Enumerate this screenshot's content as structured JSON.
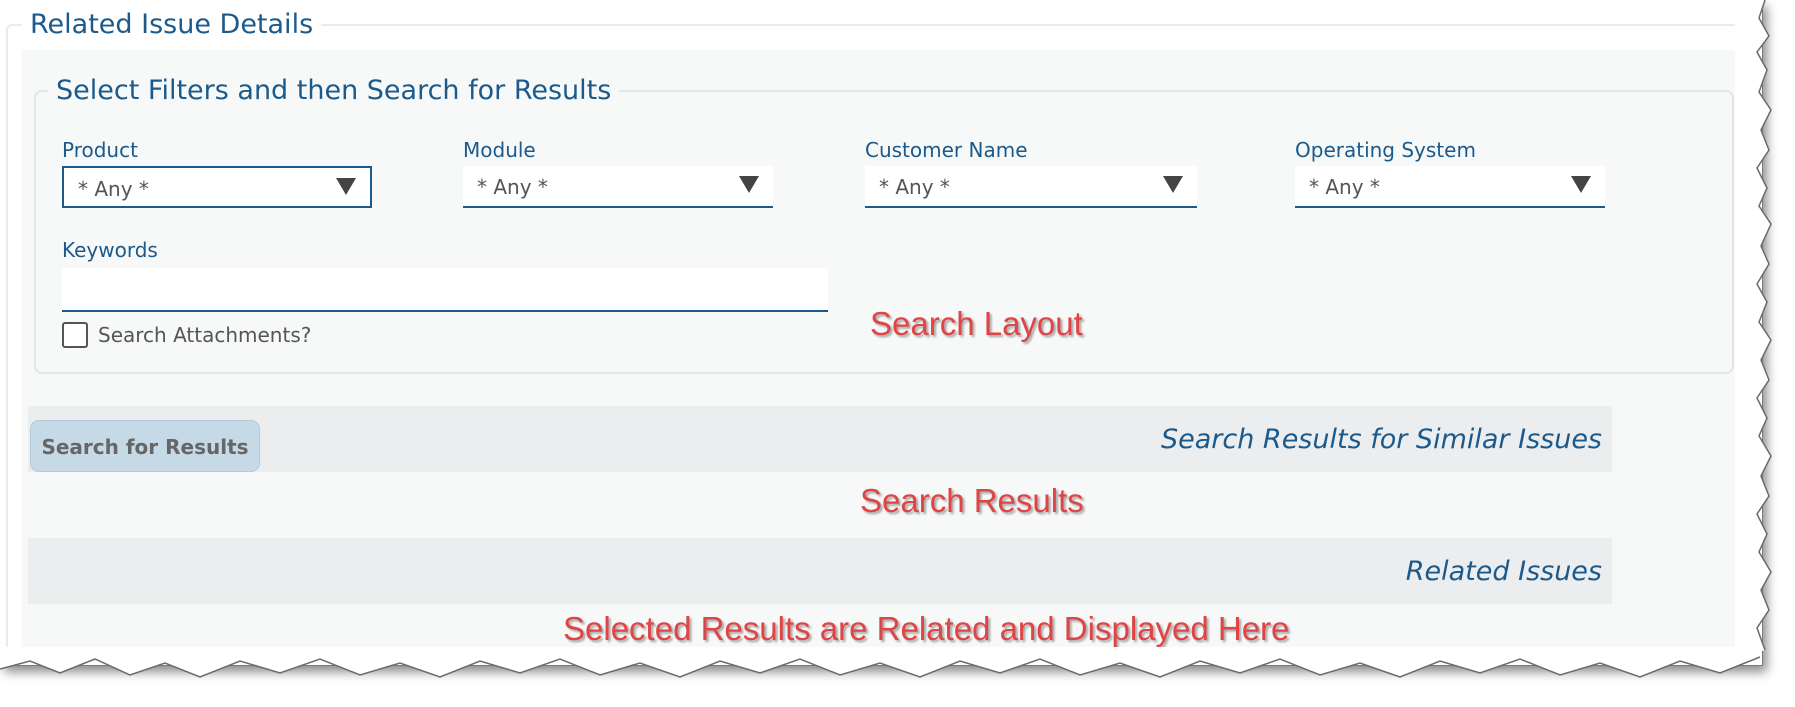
{
  "section_title": "Related Issue Details",
  "filters": {
    "legend": "Select Filters and then Search for Results",
    "product": {
      "label": "Product",
      "value": "* Any *"
    },
    "module": {
      "label": "Module",
      "value": "* Any *"
    },
    "customer_name": {
      "label": "Customer Name",
      "value": "* Any *"
    },
    "operating_system": {
      "label": "Operating System",
      "value": "* Any *"
    },
    "keywords": {
      "label": "Keywords",
      "value": ""
    },
    "search_attachments": {
      "label": "Search Attachments?",
      "checked": false
    }
  },
  "search_button_label": "Search for Results",
  "search_results_title": "Search Results for Similar Issues",
  "related_issues_title": "Related Issues",
  "annotations": {
    "search_layout": "Search Layout",
    "search_results": "Search Results",
    "selected_results": "Selected Results are Related and Displayed Here"
  },
  "colors": {
    "accent": "#1b5a8c",
    "annotation": "#e04444",
    "button_bg": "#c6d9e6"
  }
}
